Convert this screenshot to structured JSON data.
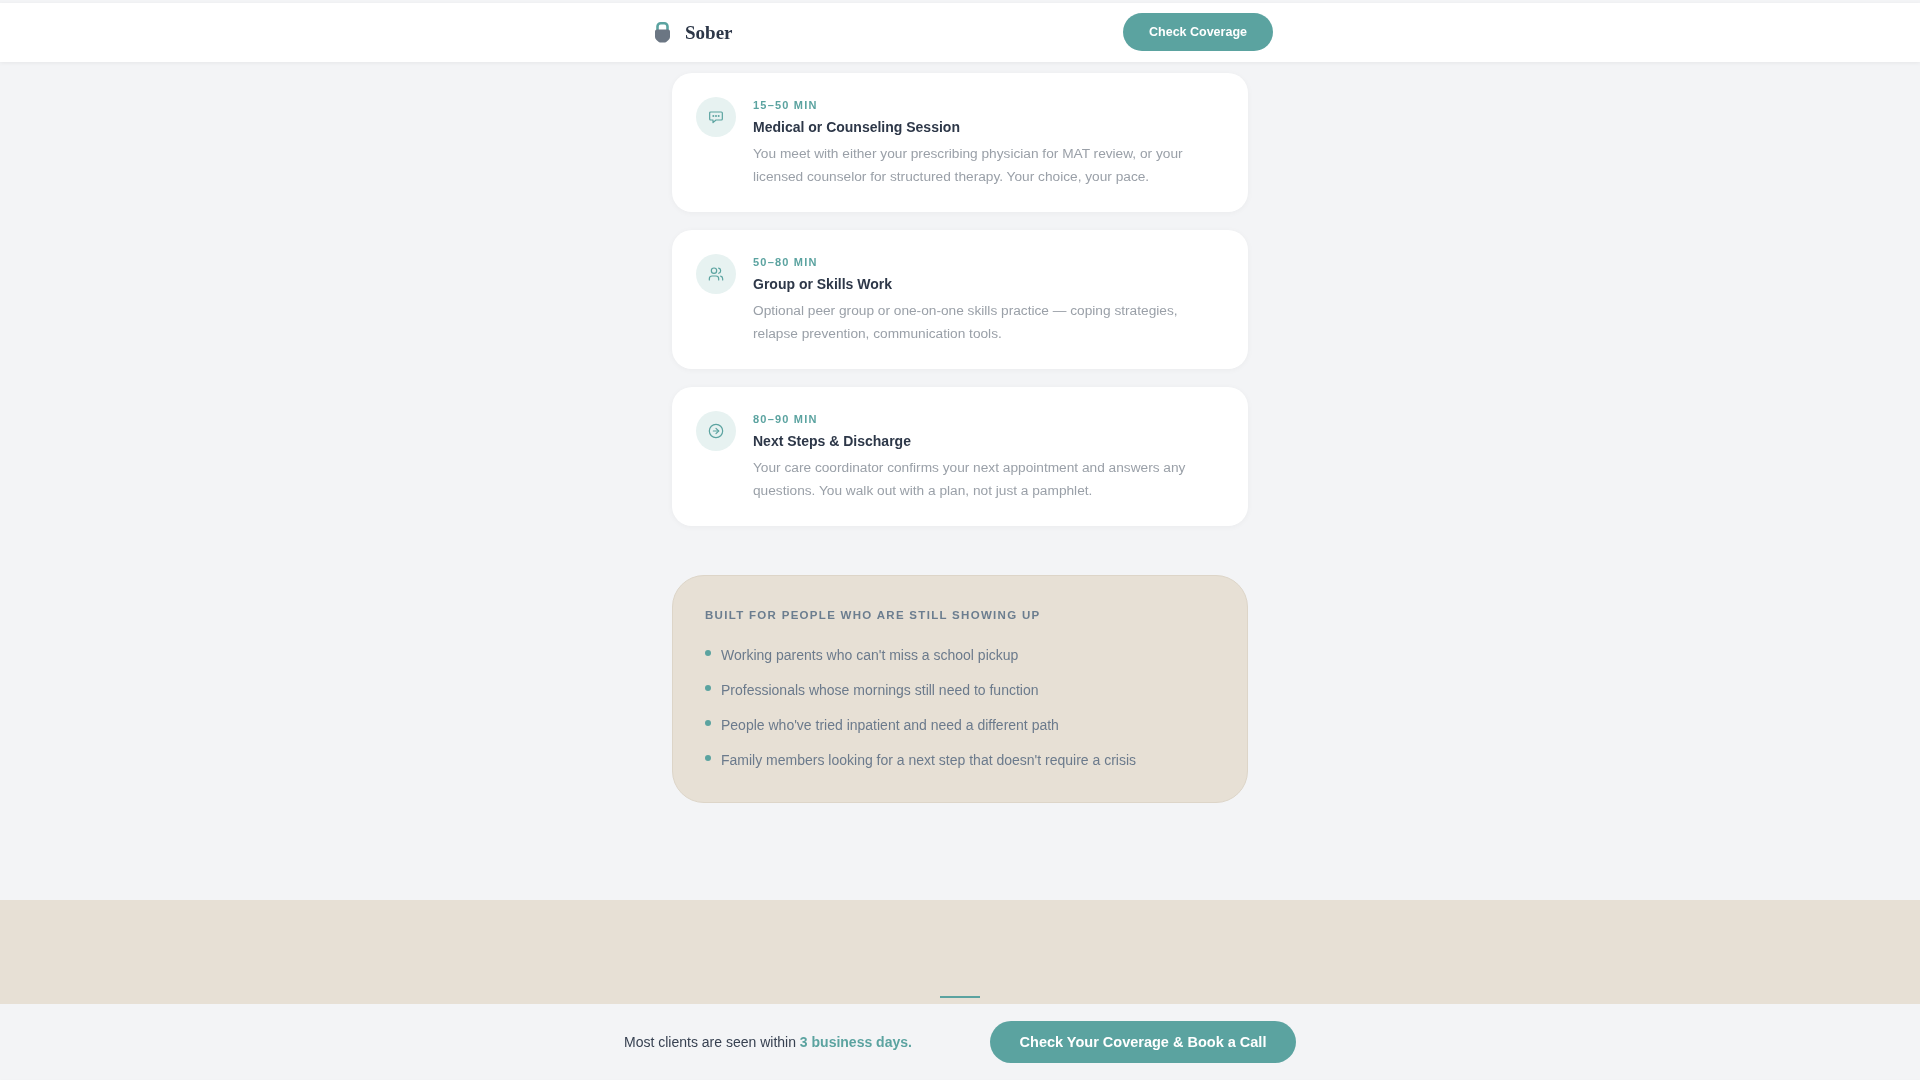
{
  "header": {
    "logo_text": "Sober",
    "button": "Check Coverage"
  },
  "steps": [
    {
      "time": "15–50 MIN",
      "title": "Medical or Counseling Session",
      "description": "You meet with either your prescribing physician for MAT review, or your licensed counselor for structured therapy. Your choice, your pace."
    },
    {
      "time": "50–80 MIN",
      "title": "Group or Skills Work",
      "description": "Optional peer group or one-on-one skills practice — coping strategies, relapse prevention, communication tools."
    },
    {
      "time": "80–90 MIN",
      "title": "Next Steps & Discharge",
      "description": "Your care coordinator confirms your next appointment and answers any questions. You walk out with a plan, not just a pamphlet."
    }
  ],
  "audience": {
    "heading": "BUILT FOR PEOPLE WHO ARE STILL SHOWING UP",
    "items": [
      "Working parents who can't miss a school pickup",
      "Professionals whose mornings still need to function",
      "People who've tried inpatient and need a different path",
      "Family members looking for a next step that doesn't require a crisis"
    ]
  },
  "bottom_bar": {
    "text": "Most clients are seen within **3 business days.**",
    "button": "Check Your Coverage & Book a Call"
  }
}
